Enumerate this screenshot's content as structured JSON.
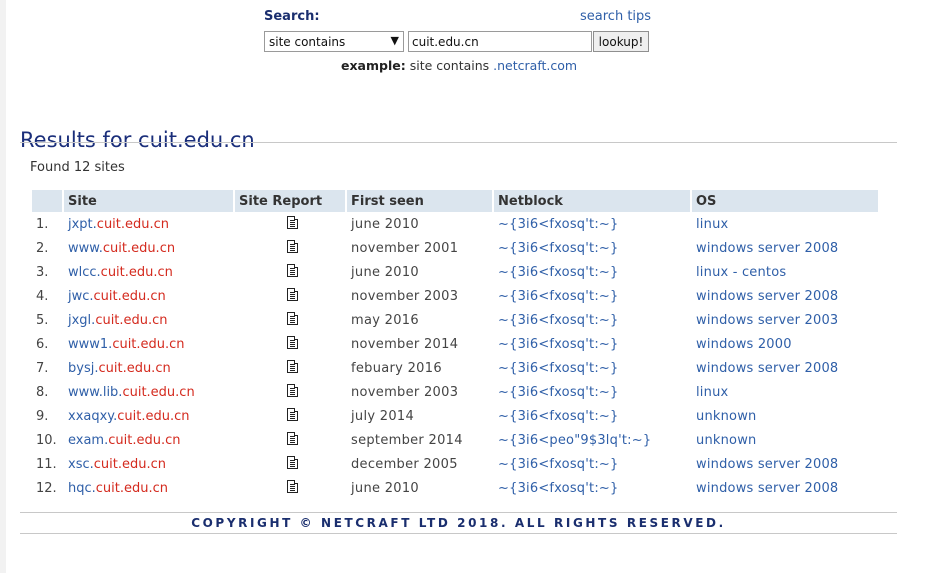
{
  "search": {
    "label": "Search:",
    "tips_link": "search tips",
    "mode_selected": "site contains",
    "query_value": "cuit.edu.cn",
    "button_label": "lookup!",
    "example_label": "example:",
    "example_text": "site contains",
    "example_link": ".netcraft.com"
  },
  "results": {
    "title": "Results for cuit.edu.cn",
    "found_text": "Found 12 sites",
    "columns": [
      "",
      "Site",
      "Site Report",
      "First seen",
      "Netblock",
      "OS"
    ],
    "rows": [
      {
        "num": "1.",
        "sub": "jxpt.",
        "domain": "cuit.edu.cn",
        "seen": "june 2010",
        "netblock": "~{3i6<fxosq't:~}",
        "os": "linux"
      },
      {
        "num": "2.",
        "sub": "www.",
        "domain": "cuit.edu.cn",
        "seen": "november 2001",
        "netblock": "~{3i6<fxosq't:~}",
        "os": "windows server 2008"
      },
      {
        "num": "3.",
        "sub": "wlcc.",
        "domain": "cuit.edu.cn",
        "seen": "june 2010",
        "netblock": "~{3i6<fxosq't:~}",
        "os": "linux - centos"
      },
      {
        "num": "4.",
        "sub": "jwc.",
        "domain": "cuit.edu.cn",
        "seen": "november 2003",
        "netblock": "~{3i6<fxosq't:~}",
        "os": "windows server 2008"
      },
      {
        "num": "5.",
        "sub": "jxgl.",
        "domain": "cuit.edu.cn",
        "seen": "may 2016",
        "netblock": "~{3i6<fxosq't:~}",
        "os": "windows server 2003"
      },
      {
        "num": "6.",
        "sub": "www1.",
        "domain": "cuit.edu.cn",
        "seen": "november 2014",
        "netblock": "~{3i6<fxosq't:~}",
        "os": "windows 2000"
      },
      {
        "num": "7.",
        "sub": "bysj.",
        "domain": "cuit.edu.cn",
        "seen": "febuary 2016",
        "netblock": "~{3i6<fxosq't:~}",
        "os": "windows server 2008"
      },
      {
        "num": "8.",
        "sub": "www.lib.",
        "domain": "cuit.edu.cn",
        "seen": "november 2003",
        "netblock": "~{3i6<fxosq't:~}",
        "os": "linux"
      },
      {
        "num": "9.",
        "sub": "xxaqxy.",
        "domain": "cuit.edu.cn",
        "seen": "july 2014",
        "netblock": "~{3i6<fxosq't:~}",
        "os": "unknown"
      },
      {
        "num": "10.",
        "sub": "exam.",
        "domain": "cuit.edu.cn",
        "seen": "september 2014",
        "netblock": "~{3i6<peo\"9$3lq't:~}",
        "os": "unknown"
      },
      {
        "num": "11.",
        "sub": "xsc.",
        "domain": "cuit.edu.cn",
        "seen": "december 2005",
        "netblock": "~{3i6<fxosq't:~}",
        "os": "windows server 2008"
      },
      {
        "num": "12.",
        "sub": "hqc.",
        "domain": "cuit.edu.cn",
        "seen": "june 2010",
        "netblock": "~{3i6<fxosq't:~}",
        "os": "windows server 2008"
      }
    ]
  },
  "footer": {
    "copyright": "COPYRIGHT © NETCRAFT LTD 2018. ALL RIGHTS RESERVED."
  },
  "colors": {
    "link": "#2f5fa8",
    "domain_highlight": "#d42a1e",
    "heading": "#1a2e7a",
    "table_header_bg": "#dbe5ee"
  },
  "icons": {
    "site_report": "document-icon",
    "select_arrow": "dropdown-arrow-icon"
  }
}
